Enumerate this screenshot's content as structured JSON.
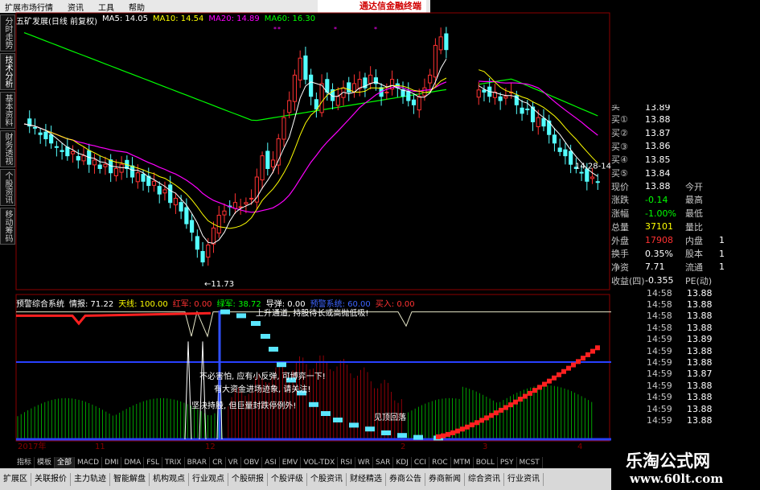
{
  "menu": {
    "items": [
      "扩展市场行情",
      "资讯",
      "工具",
      "帮助"
    ],
    "promo": "通达信金融终端"
  },
  "side_tabs": [
    "分时走势",
    "技术分析",
    "基本资料",
    "财务透视",
    "个股资讯",
    "移动筹码"
  ],
  "legend": {
    "title": "五矿发展(日线 前复权)",
    "ma5": "MA5: 14.05",
    "ma10": "MA10: 14.54",
    "ma20": "MA20: 14.89",
    "ma60": "MA60: 16.30"
  },
  "indicator_legend": {
    "name": "预警综合系统",
    "items": [
      "情报: 71.22",
      "天线: 100.00",
      "红军: 0.00",
      "绿军: 38.72",
      "导弹: 0.00",
      "预警系统: 60.00",
      "买入: 0.00"
    ]
  },
  "annotations": {
    "low": "←11.73",
    "high": "14.28-14",
    "upward": "上升通道, 持股待长或高抛低吸!",
    "rebound": "不必害怕, 应有小反弹, 可博弈一下!",
    "capital": "有大资金进场迹象, 请关注!",
    "hold": "坚决持股, 但巨量封跌停例外!",
    "top": "见顶回落",
    "year": "2017年"
  },
  "colors": {
    "ma5": "#ffffff",
    "ma10": "#ffff00",
    "ma20": "#ff00ff",
    "ma60": "#00ff00",
    "up": "#ff3232",
    "down": "#54ffff",
    "grid": "#8b0000"
  },
  "chart_data": [
    {
      "type": "candlestick",
      "title": "五矿发展(日线 前复权)",
      "y_ticks": [
        17.0,
        16.0,
        15.0,
        14.0,
        13.0,
        12.0
      ],
      "ylim": [
        11.5,
        17.6
      ],
      "annotated_low": 11.73,
      "series": [
        {
          "name": "MA5",
          "last": 14.05
        },
        {
          "name": "MA10",
          "last": 14.54
        },
        {
          "name": "MA20",
          "last": 14.89
        },
        {
          "name": "MA60",
          "last": 16.3
        }
      ],
      "closes": [
        15.25,
        15.2,
        15.15,
        15.0,
        14.9,
        14.8,
        14.7,
        14.6,
        14.5,
        14.6,
        14.4,
        14.5,
        14.3,
        14.4,
        14.2,
        14.3,
        14.1,
        14.2,
        14.3,
        14.2,
        14.0,
        14.1,
        13.9,
        13.8,
        13.9,
        13.6,
        13.7,
        13.4,
        13.5,
        13.2,
        12.9,
        12.7,
        12.3,
        12.0,
        12.4,
        12.8,
        13.1,
        13.2,
        13.3,
        13.4,
        13.3,
        13.4,
        13.5,
        14.0,
        14.5,
        14.2,
        14.4,
        14.9,
        15.4,
        15.8,
        16.4,
        16.8,
        16.3,
        15.9,
        15.6,
        16.2,
        16.0,
        15.8,
        15.9,
        16.1,
        16.0,
        16.2,
        16.3,
        16.1,
        16.4,
        16.2,
        15.9,
        16.0,
        16.3,
        16.1,
        15.9,
        15.8,
        15.7,
        15.9,
        16.1,
        16.4,
        17.1,
        17.3,
        17.0,
        16.7,
        16.4,
        16.2,
        16.1,
        16.0,
        16.05,
        16.0,
        15.9,
        16.0,
        15.8,
        15.9,
        16.0,
        15.7,
        15.5,
        15.6,
        15.3,
        15.4,
        15.2,
        15.0,
        14.8,
        14.6,
        14.5,
        14.3,
        14.2,
        14.1,
        13.9,
        14.0,
        13.88
      ]
    },
    {
      "type": "line",
      "title": "预警综合系统",
      "y_ticks": [
        100,
        80,
        60,
        40,
        20,
        0
      ],
      "ylim": [
        0,
        100
      ],
      "series": [
        {
          "name": "情报",
          "last": 71.22
        },
        {
          "name": "天线",
          "last": 100.0
        },
        {
          "name": "红军",
          "last": 0.0
        },
        {
          "name": "绿军",
          "last": 38.72
        },
        {
          "name": "导弹",
          "last": 0.0
        },
        {
          "name": "预警系统",
          "last": 60.0
        },
        {
          "name": "买入",
          "last": 0.0
        }
      ],
      "xlabels": [
        "2017年",
        "11",
        "12",
        "2",
        "3",
        "4"
      ]
    }
  ],
  "quote": {
    "rows": [
      {
        "k": "买①",
        "v": "13.88"
      },
      {
        "k": "买②",
        "v": "13.87"
      },
      {
        "k": "买③",
        "v": "13.86"
      },
      {
        "k": "买④",
        "v": "13.85"
      },
      {
        "k": "买⑤",
        "v": "13.84"
      }
    ],
    "top_partial": {
      "k": "买",
      "v": "13.89"
    },
    "stats": [
      {
        "k": "现价",
        "v": "13.88",
        "k2": "今开",
        "v2": ""
      },
      {
        "k": "涨跌",
        "v": "-0.14",
        "k2": "最高",
        "v2": ""
      },
      {
        "k": "涨幅",
        "v": "-1.00%",
        "k2": "最低",
        "v2": ""
      },
      {
        "k": "总量",
        "v": "37101",
        "k2": "量比",
        "v2": ""
      },
      {
        "k": "外盘",
        "v": "17908",
        "k2": "内盘",
        "v2": "1"
      },
      {
        "k": "换手",
        "v": "0.35%",
        "k2": "股本",
        "v2": "1"
      },
      {
        "k": "净资",
        "v": "7.71",
        "k2": "流通",
        "v2": "1"
      },
      {
        "k": "收益(四)",
        "v": "-0.355",
        "k2": "PE(动)",
        "v2": ""
      }
    ],
    "ticks": [
      {
        "t": "14:58",
        "p": "13.88"
      },
      {
        "t": "14:58",
        "p": "13.88"
      },
      {
        "t": "14:58",
        "p": "13.88"
      },
      {
        "t": "14:58",
        "p": "13.88"
      },
      {
        "t": "14:59",
        "p": "13.89"
      },
      {
        "t": "14:59",
        "p": "13.88"
      },
      {
        "t": "14:59",
        "p": "13.88"
      },
      {
        "t": "14:59",
        "p": "13.87"
      },
      {
        "t": "14:59",
        "p": "13.88"
      },
      {
        "t": "14:59",
        "p": "13.88"
      },
      {
        "t": "14:59",
        "p": "13.88"
      },
      {
        "t": "14:59",
        "p": "13.88"
      }
    ]
  },
  "bottom_tabs": [
    "指标",
    "模板",
    "全部",
    "MACD",
    "DMI",
    "DMA",
    "FSL",
    "TRIX",
    "BRAR",
    "CR",
    "VR",
    "OBV",
    "ASI",
    "EMV",
    "VOL-TDX",
    "RSI",
    "WR",
    "SAR",
    "KDJ",
    "CCI",
    "ROC",
    "MTM",
    "BOLL",
    "PSY",
    "MCST"
  ],
  "footer_nav": [
    "扩展区",
    "关联报价",
    "主力轨迹",
    "智能解盘",
    "机构观点",
    "行业观点",
    "个股研报",
    "个股评级",
    "个股资讯",
    "财经精选",
    "券商公告",
    "券商新闻",
    "综合资讯",
    "行业资讯"
  ],
  "watermark": {
    "line1": "乐淘公式网",
    "line2": "www.60lt.com"
  }
}
